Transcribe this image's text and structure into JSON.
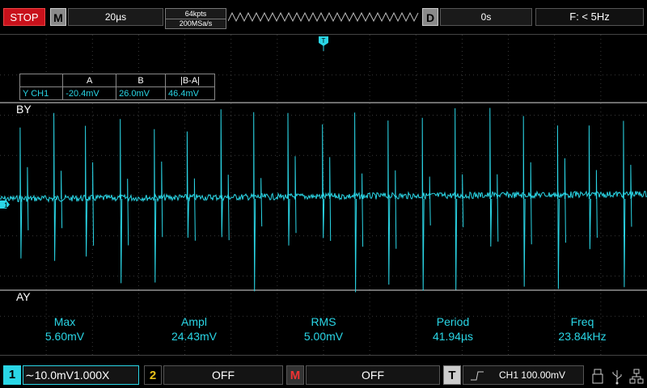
{
  "topbar": {
    "run_state": "STOP",
    "mode_tag": "M",
    "timebase": "20µs",
    "memory_depth": "64kpts",
    "sample_rate": "200MSa/s",
    "delay_tag": "D",
    "delay_value": "0s",
    "trigger_freq": "F: < 5Hz"
  },
  "screen": {
    "trigger_marker": "T",
    "cursor_top_label": "BY",
    "cursor_bottom_label": "AY",
    "channel_marker": "1",
    "trace_color": "#2ad6e6",
    "cursor_table": {
      "headers": [
        "",
        "A",
        "B",
        "|B-A|"
      ],
      "row": [
        "Y CH1",
        "-20.4mV",
        "26.0mV",
        "46.4mV"
      ]
    }
  },
  "measurements": [
    {
      "label": "Max",
      "value": "5.60mV"
    },
    {
      "label": "Ampl",
      "value": "24.43mV"
    },
    {
      "label": "RMS",
      "value": "5.00mV"
    },
    {
      "label": "Period",
      "value": "41.94µs"
    },
    {
      "label": "Freq",
      "value": "23.84kHz"
    }
  ],
  "bottombar": {
    "ch1_num": "1",
    "ch1_setting": "∼10.0mV1.000X",
    "ch2_num": "2",
    "ch2_state": "OFF",
    "math_tag": "M",
    "math_state": "OFF",
    "trig_tag": "T",
    "trig_info": "CH1  100.00mV"
  },
  "colors": {
    "ch1": "#2ad6e6",
    "ch2": "#e8c21a",
    "math": "#c8111b",
    "stop": "#c8111b"
  },
  "icons": [
    "trigger-edge-icon",
    "usb-storage-icon",
    "usb-icon",
    "network-icon"
  ]
}
